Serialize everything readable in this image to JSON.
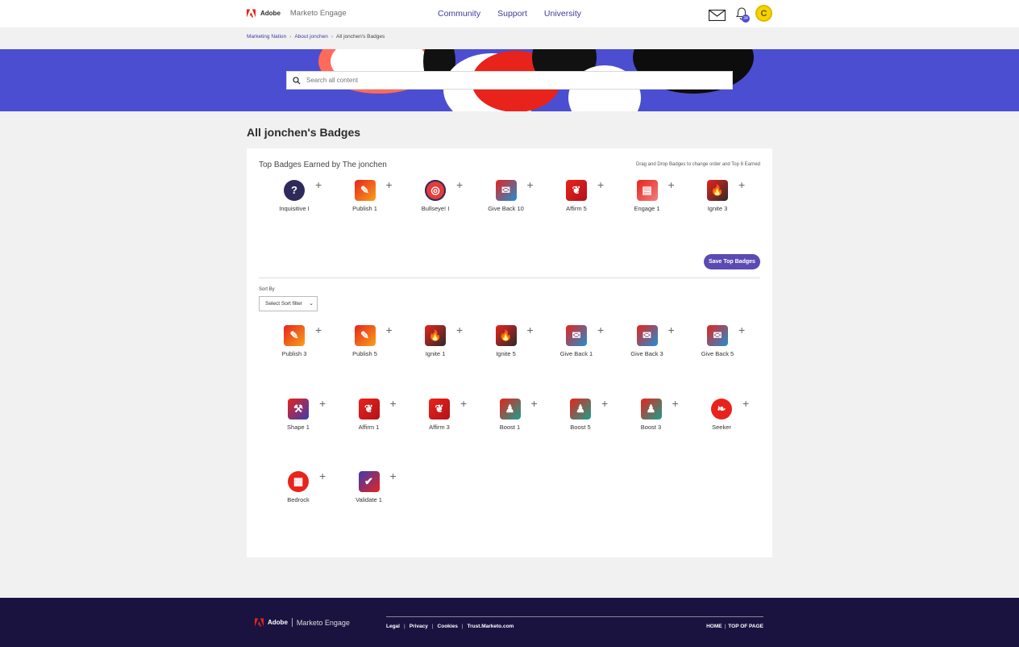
{
  "header": {
    "brand": "Adobe",
    "product": "Marketo Engage",
    "nav": [
      "Community",
      "Support",
      "University"
    ],
    "notification_count": "34"
  },
  "breadcrumb": [
    "Marketing Nation",
    "About jonchen",
    "All jonchen's Badges"
  ],
  "search": {
    "placeholder": "Search all content"
  },
  "page_title": "All jonchen's Badges",
  "top_badges": {
    "heading": "Top Badges Earned by The jonchen",
    "hint": "Drag and Drop Badges to change order and Top 8 Earned",
    "items": [
      "Inquisitive I",
      "Publish 1",
      "Bullseye! I",
      "Give Back 10",
      "Affirm 5",
      "Engage 1",
      "Ignite 3"
    ],
    "save_label": "Save Top Badges"
  },
  "sort": {
    "label": "Sort By",
    "selected": "Select Sort filter"
  },
  "all_badges": [
    "Publish 3",
    "Publish 5",
    "Ignite 1",
    "Ignite 5",
    "Give Back 1",
    "Give Back 3",
    "Give Back 5",
    "Shape 1",
    "Affirm 1",
    "Affirm 3",
    "Boost 1",
    "Boost 5",
    "Boost 3",
    "Seeker",
    "Bedrock",
    "Validate 1"
  ],
  "footer": {
    "brand": "Adobe",
    "product": "Marketo Engage",
    "links": [
      "Legal",
      "Privacy",
      "Cookies",
      "Trust.Marketo.com"
    ],
    "right_links": [
      "HOME",
      "TOP OF PAGE"
    ]
  },
  "colors": {
    "accent": "#4b4ed0",
    "button": "#5a4ab2",
    "link": "#3f3d9c",
    "footer": "#1a1340"
  }
}
